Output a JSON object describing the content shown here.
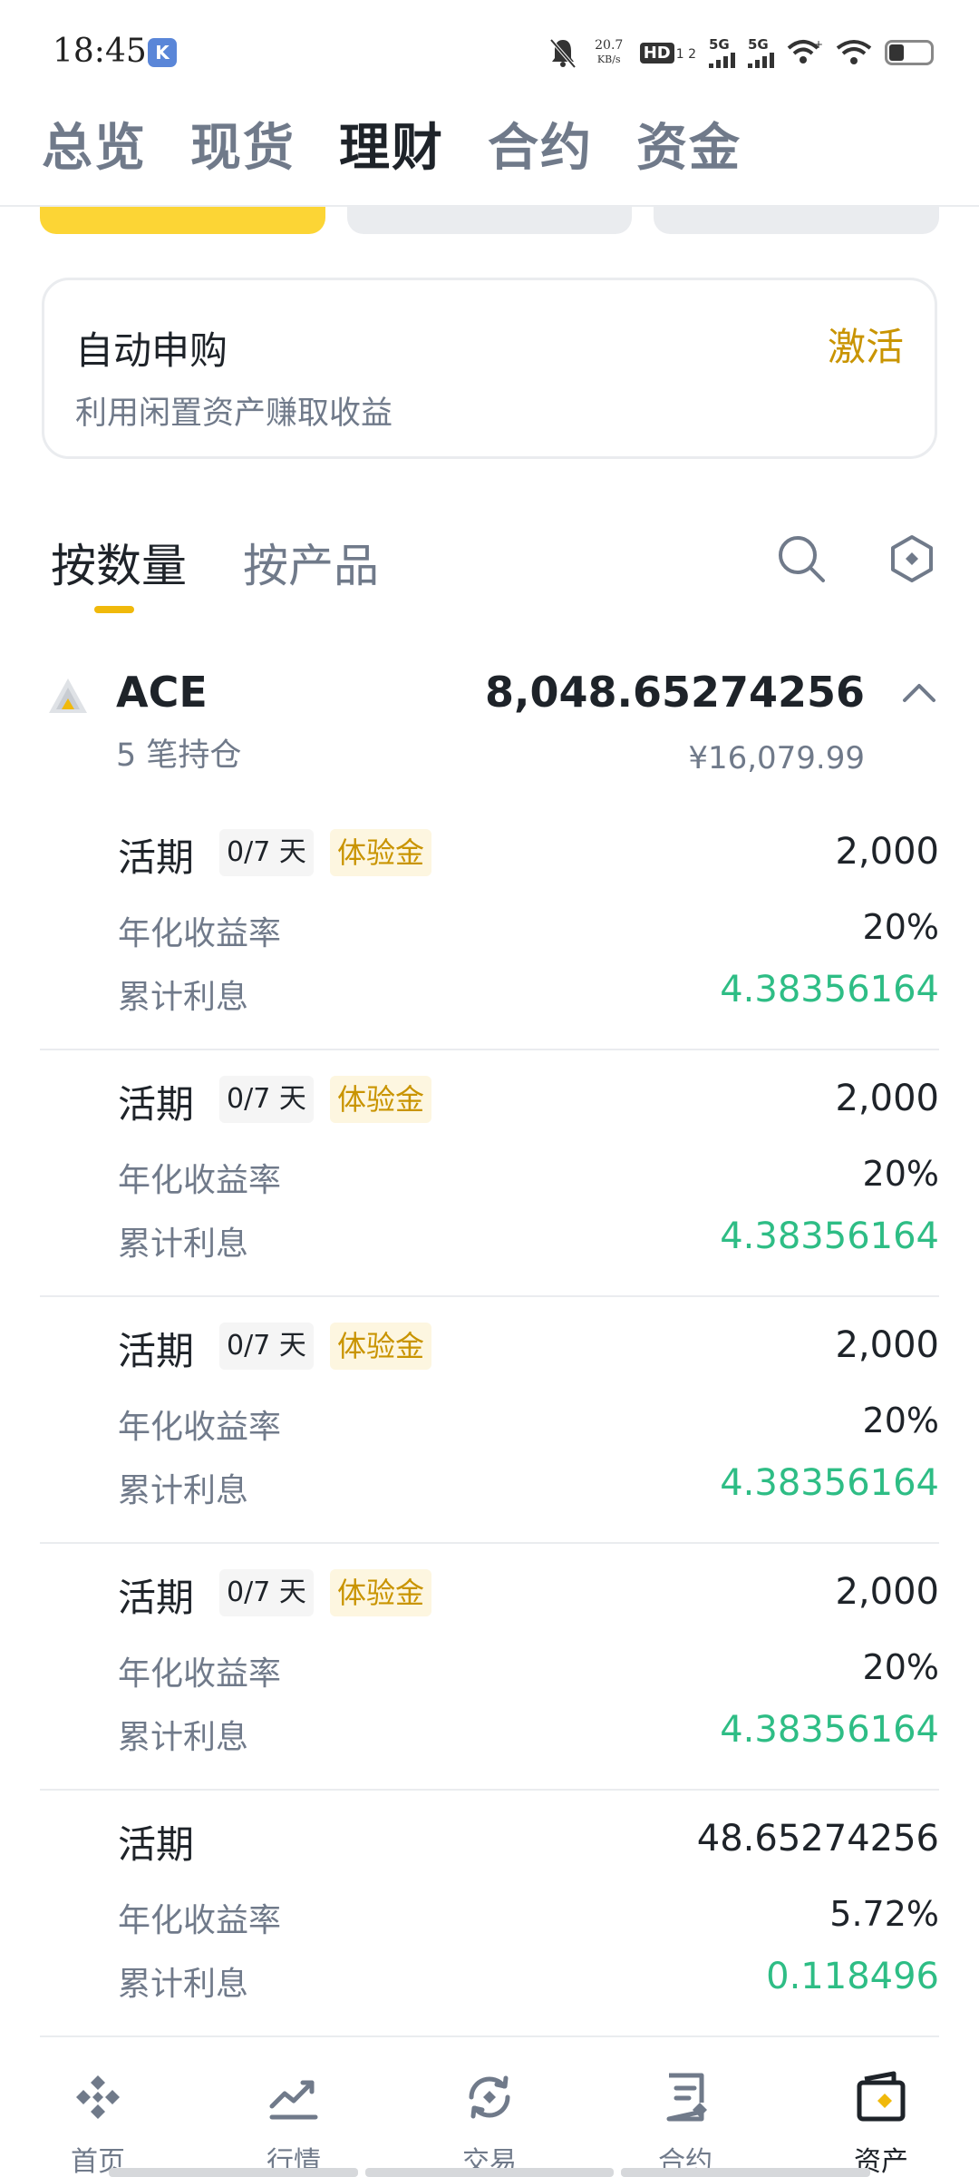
{
  "status_bar": {
    "time": "18:45",
    "net_speed_value": "20.7",
    "net_speed_unit": "KB/s",
    "hd_label": "HD",
    "hd_sub": "1 2",
    "sig1_label": "5G",
    "sig2_label": "5G",
    "icons": [
      "app-icon",
      "mute-bell-icon",
      "hd-icon",
      "signal-icon",
      "signal-icon",
      "wifi-call-icon",
      "wifi-icon",
      "battery-icon"
    ]
  },
  "top_tabs": [
    "总览",
    "现货",
    "理财",
    "合约",
    "资金"
  ],
  "top_tab_active": "理财",
  "auto_subscribe": {
    "title": "自动申购",
    "subtitle": "利用闲置资产赚取收益",
    "action": "激活"
  },
  "sub_tabs": [
    "按数量",
    "按产品"
  ],
  "sub_tab_active": "按数量",
  "asset": {
    "name": "ACE",
    "amount": "8,048.65274256",
    "positions": "5 笔持仓",
    "cny_value": "¥16,079.99"
  },
  "positions": [
    {
      "type": "活期",
      "days": "0/7 天",
      "badge": "体验金",
      "amount": "2,000",
      "rate_label": "年化收益率",
      "rate": "20%",
      "interest_label": "累计利息",
      "interest": "4.38356164"
    },
    {
      "type": "活期",
      "days": "0/7 天",
      "badge": "体验金",
      "amount": "2,000",
      "rate_label": "年化收益率",
      "rate": "20%",
      "interest_label": "累计利息",
      "interest": "4.38356164"
    },
    {
      "type": "活期",
      "days": "0/7 天",
      "badge": "体验金",
      "amount": "2,000",
      "rate_label": "年化收益率",
      "rate": "20%",
      "interest_label": "累计利息",
      "interest": "4.38356164"
    },
    {
      "type": "活期",
      "days": "0/7 天",
      "badge": "体验金",
      "amount": "2,000",
      "rate_label": "年化收益率",
      "rate": "20%",
      "interest_label": "累计利息",
      "interest": "4.38356164"
    },
    {
      "type": "活期",
      "days": "",
      "badge": "",
      "amount": "48.65274256",
      "rate_label": "年化收益率",
      "rate": "5.72%",
      "interest_label": "累计利息",
      "interest": "0.118496"
    }
  ],
  "bottom_nav": [
    {
      "label": "首页",
      "icon": "home-diamond-icon"
    },
    {
      "label": "行情",
      "icon": "market-chart-icon"
    },
    {
      "label": "交易",
      "icon": "trade-exchange-icon"
    },
    {
      "label": "合约",
      "icon": "futures-doc-icon"
    },
    {
      "label": "资产",
      "icon": "wallet-icon"
    }
  ],
  "bottom_nav_active": "资产",
  "colors": {
    "accent_yellow": "#fcd535",
    "accent_gold": "#c99400",
    "positive_green": "#2ebd85",
    "text_primary": "#1e2329",
    "text_secondary": "#707a8a"
  }
}
